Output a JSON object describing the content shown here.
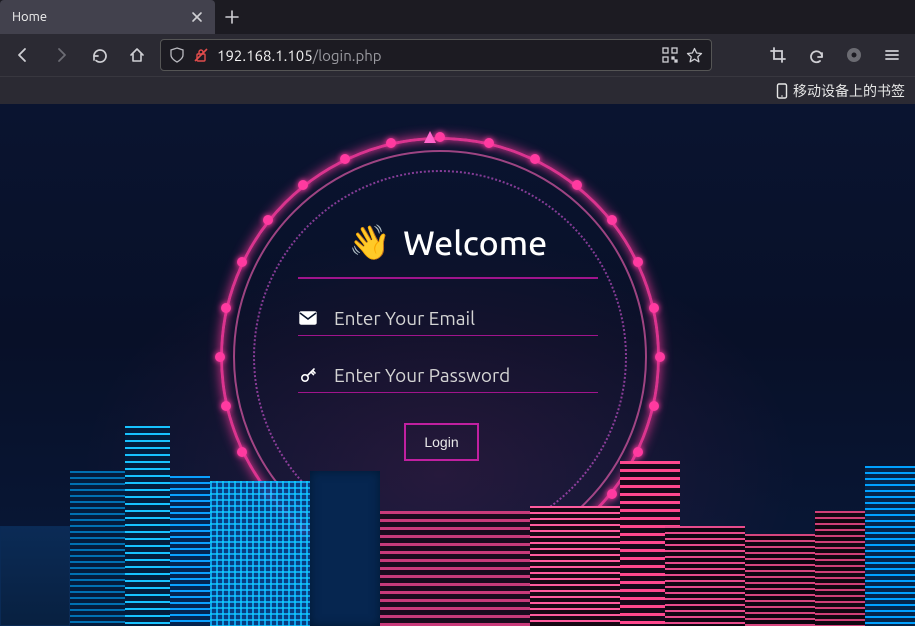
{
  "browser": {
    "tab_title": "Home",
    "url_host": "192.168.1.105",
    "url_path": "/login.php"
  },
  "bookmarks_bar": {
    "mobile_bookmarks_label": "移动设备上的书签"
  },
  "login": {
    "heading": "Welcome",
    "wave_emoji": "👋",
    "email_placeholder": "Enter Your Email",
    "password_placeholder": "Enter Your Password",
    "login_button_label": "Login"
  },
  "colors": {
    "accent": "#a0148c",
    "button_border": "#c020a0"
  }
}
